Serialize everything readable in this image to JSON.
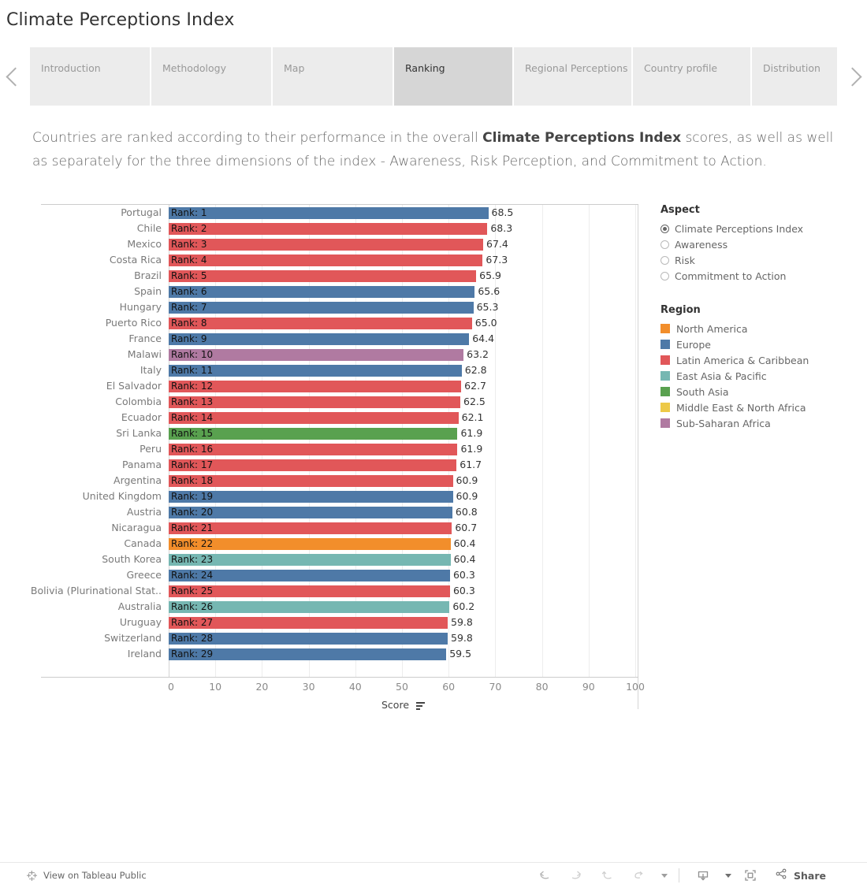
{
  "header": {
    "title": "Climate Perceptions Index"
  },
  "tabs": {
    "prev_arrow": "chevron-left",
    "next_arrow": "chevron-right",
    "items": [
      {
        "label": "Introduction",
        "active": false
      },
      {
        "label": "Methodology",
        "active": false
      },
      {
        "label": "Map",
        "active": false
      },
      {
        "label": "Ranking",
        "active": true
      },
      {
        "label": "Regional Perceptions",
        "active": false
      },
      {
        "label": "Country profile",
        "active": false
      },
      {
        "label": "Distribution",
        "active": false
      }
    ]
  },
  "description": {
    "part1": "Countries are ranked according to their performance in the overall ",
    "bold": "Climate Perceptions Index",
    "part2": " scores, as well as well as separately for the three dimensions of the index - Awareness, Risk Perception, and Commitment to Action."
  },
  "aspect_filter": {
    "title": "Aspect",
    "options": [
      {
        "label": "Climate Perceptions Index",
        "selected": true
      },
      {
        "label": "Awareness",
        "selected": false
      },
      {
        "label": "Risk",
        "selected": false
      },
      {
        "label": "Commitment to Action",
        "selected": false
      }
    ]
  },
  "region_legend": {
    "title": "Region",
    "items": [
      {
        "label": "North America",
        "color": "#F28E2B"
      },
      {
        "label": "Europe",
        "color": "#4E79A7"
      },
      {
        "label": "Latin America & Caribbean",
        "color": "#E15759"
      },
      {
        "label": "East Asia & Pacific",
        "color": "#76B7B2"
      },
      {
        "label": "South Asia",
        "color": "#59A14F"
      },
      {
        "label": "Middle East & North Africa",
        "color": "#EDC948"
      },
      {
        "label": "Sub-Saharan Africa",
        "color": "#B07AA1"
      }
    ]
  },
  "chart_data": {
    "type": "bar",
    "title": "",
    "orientation": "horizontal",
    "xlabel": "Score",
    "ylabel": "",
    "xlim": [
      0,
      100
    ],
    "xticks": [
      0,
      10,
      20,
      30,
      40,
      50,
      60,
      70,
      80,
      90,
      100
    ],
    "grid": true,
    "sort": "descending",
    "legend_position": "right",
    "categories": [
      "Portugal",
      "Chile",
      "Mexico",
      "Costa Rica",
      "Brazil",
      "Spain",
      "Hungary",
      "Puerto Rico",
      "France",
      "Malawi",
      "Italy",
      "El Salvador",
      "Colombia",
      "Ecuador",
      "Sri Lanka",
      "Peru",
      "Panama",
      "Argentina",
      "United Kingdom",
      "Austria",
      "Nicaragua",
      "Canada",
      "South Korea",
      "Greece",
      "Bolivia (Plurinational Stat..",
      "Australia",
      "Uruguay",
      "Switzerland",
      "Ireland"
    ],
    "values": [
      68.5,
      68.3,
      67.4,
      67.3,
      65.9,
      65.6,
      65.3,
      65.0,
      64.4,
      63.2,
      62.8,
      62.7,
      62.5,
      62.1,
      61.9,
      61.9,
      61.7,
      60.9,
      60.9,
      60.8,
      60.7,
      60.4,
      60.4,
      60.3,
      60.3,
      60.2,
      59.8,
      59.8,
      59.5
    ],
    "bar_labels": [
      "Rank: 1",
      "Rank: 2",
      "Rank: 3",
      "Rank: 4",
      "Rank: 5",
      "Rank: 6",
      "Rank: 7",
      "Rank: 8",
      "Rank: 9",
      "Rank: 10",
      "Rank: 11",
      "Rank: 12",
      "Rank: 13",
      "Rank: 14",
      "Rank: 15",
      "Rank: 16",
      "Rank: 17",
      "Rank: 18",
      "Rank: 19",
      "Rank: 20",
      "Rank: 21",
      "Rank: 22",
      "Rank: 23",
      "Rank: 24",
      "Rank: 25",
      "Rank: 26",
      "Rank: 27",
      "Rank: 28",
      "Rank: 29"
    ],
    "value_labels": [
      "68.5",
      "68.3",
      "67.4",
      "67.3",
      "65.9",
      "65.6",
      "65.3",
      "65.0",
      "64.4",
      "63.2",
      "62.8",
      "62.7",
      "62.5",
      "62.1",
      "61.9",
      "61.9",
      "61.7",
      "60.9",
      "60.9",
      "60.8",
      "60.7",
      "60.4",
      "60.4",
      "60.3",
      "60.3",
      "60.2",
      "59.8",
      "59.8",
      "59.5"
    ],
    "regions": [
      "Europe",
      "Latin America & Caribbean",
      "Latin America & Caribbean",
      "Latin America & Caribbean",
      "Latin America & Caribbean",
      "Europe",
      "Europe",
      "Latin America & Caribbean",
      "Europe",
      "Sub-Saharan Africa",
      "Europe",
      "Latin America & Caribbean",
      "Latin America & Caribbean",
      "Latin America & Caribbean",
      "South Asia",
      "Latin America & Caribbean",
      "Latin America & Caribbean",
      "Latin America & Caribbean",
      "Europe",
      "Europe",
      "Latin America & Caribbean",
      "North America",
      "East Asia & Pacific",
      "Europe",
      "Latin America & Caribbean",
      "East Asia & Pacific",
      "Latin America & Caribbean",
      "Europe",
      "Europe"
    ],
    "colors": [
      "#4E79A7",
      "#E15759",
      "#E15759",
      "#E15759",
      "#E15759",
      "#4E79A7",
      "#4E79A7",
      "#E15759",
      "#4E79A7",
      "#B07AA1",
      "#4E79A7",
      "#E15759",
      "#E15759",
      "#E15759",
      "#59A14F",
      "#E15759",
      "#E15759",
      "#E15759",
      "#4E79A7",
      "#4E79A7",
      "#E15759",
      "#F28E2B",
      "#76B7B2",
      "#4E79A7",
      "#E15759",
      "#76B7B2",
      "#E15759",
      "#4E79A7",
      "#4E79A7"
    ]
  },
  "toolbar": {
    "tableau_public_label": "View on Tableau Public",
    "share_label": "Share",
    "buttons": [
      "undo",
      "redo",
      "revert",
      "refresh",
      "download",
      "fullscreen"
    ]
  }
}
